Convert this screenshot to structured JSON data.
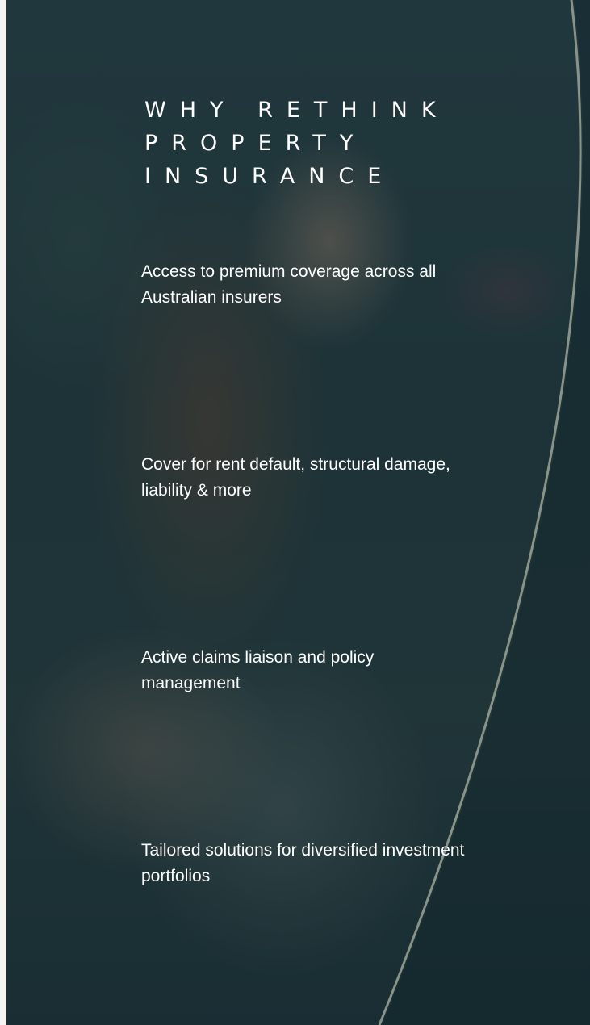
{
  "heading": {
    "line1": "WHY RETHINK",
    "line2": "PROPERTY",
    "line3": "INSURANCE"
  },
  "features": [
    "Access to premium coverage across all Australian insurers",
    "Cover for rent default, structural damage, liability & more",
    "Active claims liaison and policy management",
    "Tailored solutions for diversified investment portfolios"
  ],
  "colors": {
    "overlay": "#1e3a40",
    "text": "#ffffff",
    "arc": "#8a9388",
    "left_strip": "#f4f4f2"
  }
}
